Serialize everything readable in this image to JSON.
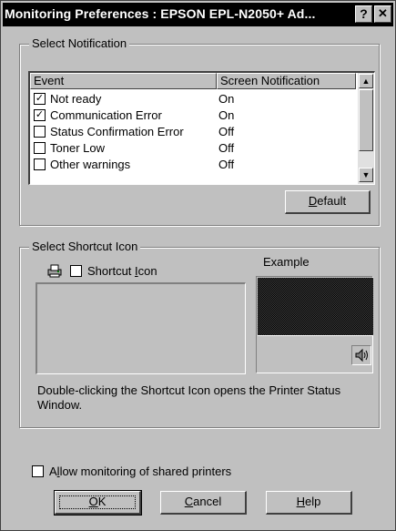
{
  "window": {
    "title": "Monitoring Preferences : EPSON EPL-N2050+ Ad...",
    "help_glyph": "?",
    "close_glyph": "✕"
  },
  "notification": {
    "group_label": "Select Notification",
    "columns": [
      "Event",
      "Screen Notification"
    ],
    "rows": [
      {
        "event": "Not ready",
        "value": "On",
        "checked": true
      },
      {
        "event": "Communication Error",
        "value": "On",
        "checked": true
      },
      {
        "event": "Status Confirmation Error",
        "value": "Off",
        "checked": false
      },
      {
        "event": "Toner Low",
        "value": "Off",
        "checked": false
      },
      {
        "event": "Other warnings",
        "value": "Off",
        "checked": false
      }
    ],
    "default_button": {
      "accel": "D",
      "rest": "efault"
    }
  },
  "shortcut": {
    "group_label": "Select Shortcut Icon",
    "checkbox_pre": "Shortcut ",
    "checkbox_accel": "I",
    "checkbox_post": "con",
    "example_label": "Example",
    "description": "Double-clicking the Shortcut Icon opens the Printer Status Window."
  },
  "footer": {
    "shared_pre": "A",
    "shared_accel": "l",
    "shared_post": "low monitoring of shared printers",
    "ok": {
      "accel": "O",
      "rest": "K"
    },
    "cancel": {
      "accel": "C",
      "rest": "ancel"
    },
    "help": {
      "accel": "H",
      "rest": "elp"
    }
  },
  "icons": {
    "printer": "printer-icon",
    "speaker": "speaker-icon",
    "checkmark": "✓"
  }
}
